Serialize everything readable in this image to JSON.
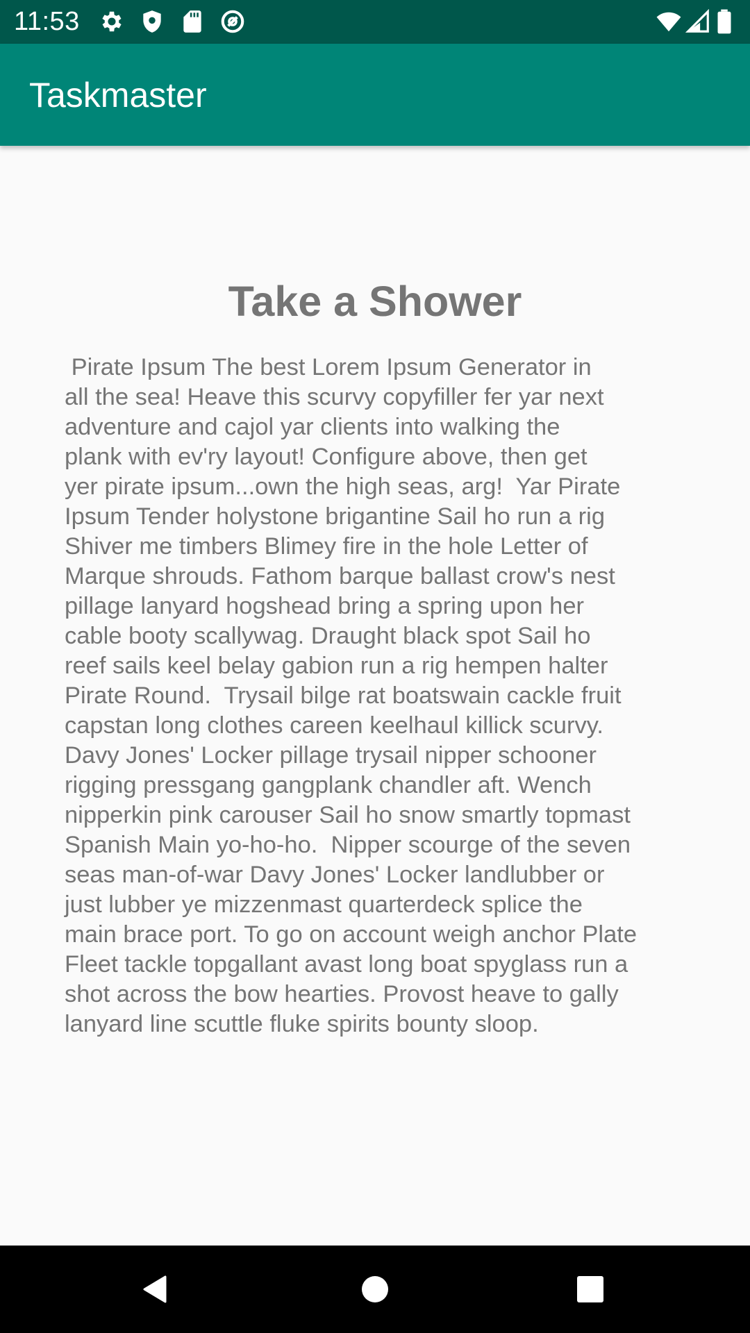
{
  "status_bar": {
    "time": "11:53",
    "left_icons": [
      "gear-icon",
      "shield-icon",
      "sd-card-icon",
      "at-sign-icon"
    ],
    "right_icons": [
      "wifi-icon",
      "cell-signal-icon",
      "battery-icon"
    ]
  },
  "app_bar": {
    "title": "Taskmaster",
    "color": "#008577",
    "status_color": "#00574b"
  },
  "task": {
    "title": "Take a Shower",
    "body": " Pirate Ipsum The best Lorem Ipsum Generator in\nall the sea! Heave this scurvy copyfiller fer yar next\nadventure and cajol yar clients into walking the\nplank with ev'ry layout! Configure above, then get\nyer pirate ipsum...own the high seas, arg!  Yar Pirate\nIpsum Tender holystone brigantine Sail ho run a rig\nShiver me timbers Blimey fire in the hole Letter of\nMarque shrouds. Fathom barque ballast crow's nest\npillage lanyard hogshead bring a spring upon her\ncable booty scallywag. Draught black spot Sail ho\nreef sails keel belay gabion run a rig hempen halter\nPirate Round.  Trysail bilge rat boatswain cackle fruit\ncapstan long clothes careen keelhaul killick scurvy.\nDavy Jones' Locker pillage trysail nipper schooner\nrigging pressgang gangplank chandler aft. Wench\nnipperkin pink carouser Sail ho snow smartly topmast\nSpanish Main yo-ho-ho.  Nipper scourge of the seven\nseas man-of-war Davy Jones' Locker landlubber or\njust lubber ye mizzenmast quarterdeck splice the\nmain brace port. To go on account weigh anchor Plate\nFleet tackle topgallant avast long boat spyglass run a\nshot across the bow hearties. Provost heave to gally\nlanyard line scuttle fluke spirits bounty sloop."
  },
  "nav_bar": {
    "buttons": [
      "back-icon",
      "home-icon",
      "recents-icon"
    ]
  }
}
